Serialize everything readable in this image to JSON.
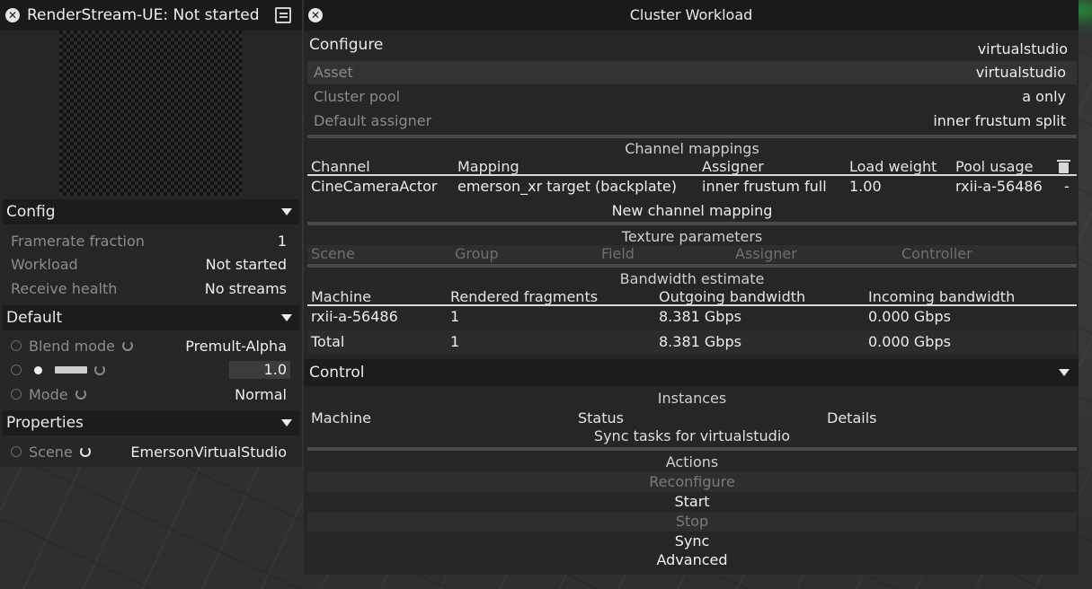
{
  "left_panel": {
    "title": "RenderStream-UE: Not started",
    "sections": {
      "config": {
        "label": "Config",
        "rows": [
          {
            "key": "Framerate fraction",
            "value": "1"
          },
          {
            "key": "Workload",
            "value": "Not started"
          },
          {
            "key": "Receive health",
            "value": "No streams"
          }
        ]
      },
      "default": {
        "label": "Default",
        "blend_mode": {
          "key": "Blend mode",
          "value": "Premult-Alpha"
        },
        "brightness": {
          "value": "1.0"
        },
        "mode": {
          "key": "Mode",
          "value": "Normal"
        }
      },
      "properties": {
        "label": "Properties",
        "scene": {
          "key": "Scene",
          "value": "EmersonVirtualStudio"
        }
      }
    }
  },
  "cluster": {
    "title": "Cluster Workload",
    "configure": {
      "label": "Configure",
      "value": "virtualstudio",
      "rows": [
        {
          "key": "Asset",
          "value": "virtualstudio"
        },
        {
          "key": "Cluster pool",
          "value": "a only"
        },
        {
          "key": "Default assigner",
          "value": "inner frustum split"
        }
      ]
    },
    "channel_mappings": {
      "label": "Channel mappings",
      "headers": [
        "Channel",
        "Mapping",
        "Assigner",
        "Load weight",
        "Pool usage"
      ],
      "rows": [
        [
          "CineCameraActor",
          "emerson_xr target (backplate)",
          "inner frustum full",
          "1.00",
          "rxii-a-56486",
          "-"
        ]
      ],
      "new_button": "New channel mapping"
    },
    "texture_parameters": {
      "label": "Texture parameters",
      "headers": [
        "Scene",
        "Group",
        "Field",
        "Assigner",
        "Controller"
      ]
    },
    "bandwidth": {
      "label": "Bandwidth estimate",
      "headers": [
        "Machine",
        "Rendered fragments",
        "Outgoing bandwidth",
        "Incoming bandwidth"
      ],
      "rows": [
        [
          "rxii-a-56486",
          "1",
          "8.381 Gbps",
          "0.000 Gbps"
        ],
        [
          "Total",
          "1",
          "8.381 Gbps",
          "0.000 Gbps"
        ]
      ]
    },
    "control": {
      "label": "Control",
      "instances_label": "Instances",
      "instances_headers": [
        "Machine",
        "Status",
        "Details"
      ],
      "sync_tasks": "Sync tasks for virtualstudio"
    },
    "actions": {
      "label": "Actions",
      "reconfigure": "Reconfigure",
      "start": "Start",
      "stop": "Stop",
      "sync": "Sync",
      "advanced": "Advanced"
    }
  }
}
